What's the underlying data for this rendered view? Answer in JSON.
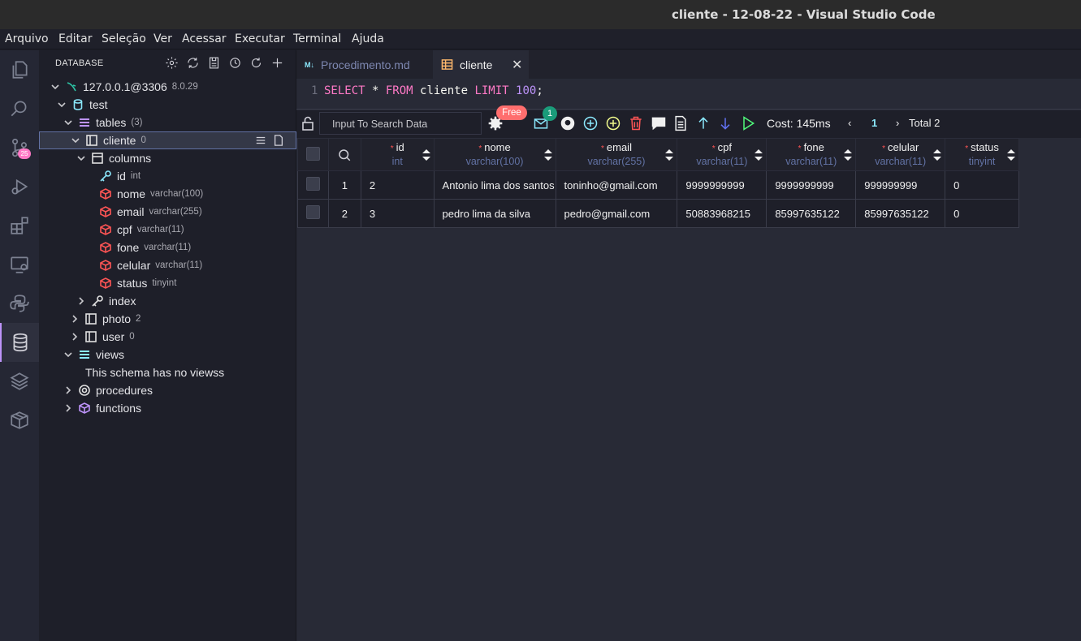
{
  "window": {
    "title": "cliente - 12-08-22 - Visual Studio Code"
  },
  "menu": [
    "Arquivo",
    "Editar",
    "Seleção",
    "Ver",
    "Acessar",
    "Executar",
    "Terminal",
    "Ajuda"
  ],
  "activity": {
    "scm_badge": "25"
  },
  "sidebar": {
    "header": "DATABASE",
    "connection": {
      "label": "127.0.0.1@3306",
      "version": "8.0.29"
    },
    "schema": "test",
    "tables": {
      "label": "tables",
      "count": "(3)"
    },
    "cliente": {
      "label": "cliente",
      "count": "0"
    },
    "columns_label": "columns",
    "columns": [
      {
        "name": "id",
        "type": "int"
      },
      {
        "name": "nome",
        "type": "varchar(100)"
      },
      {
        "name": "email",
        "type": "varchar(255)"
      },
      {
        "name": "cpf",
        "type": "varchar(11)"
      },
      {
        "name": "fone",
        "type": "varchar(11)"
      },
      {
        "name": "celular",
        "type": "varchar(11)"
      },
      {
        "name": "status",
        "type": "tinyint"
      }
    ],
    "index_label": "index",
    "photo": {
      "label": "photo",
      "count": "2"
    },
    "user": {
      "label": "user",
      "count": "0"
    },
    "views_label": "views",
    "views_empty": "This schema has no viewss",
    "procedures_label": "procedures",
    "functions_label": "functions"
  },
  "tabs": [
    {
      "label": "Procedimento.md",
      "icon": "M↓"
    },
    {
      "label": "cliente"
    }
  ],
  "editor": {
    "line": "1",
    "select": "SELECT",
    "star": " * ",
    "from": "FROM",
    "table": " cliente ",
    "limit": "LIMIT",
    "num": "100",
    "semi": ";"
  },
  "toolbar": {
    "search_placeholder": "Input To Search Data",
    "free_badge": "Free",
    "mail_badge": "1",
    "cost": "Cost: 145ms",
    "page": "1",
    "total": "Total 2"
  },
  "grid": {
    "columns": [
      {
        "name": "id",
        "type": "int"
      },
      {
        "name": "nome",
        "type": "varchar(100)"
      },
      {
        "name": "email",
        "type": "varchar(255)"
      },
      {
        "name": "cpf",
        "type": "varchar(11)"
      },
      {
        "name": "fone",
        "type": "varchar(11)"
      },
      {
        "name": "celular",
        "type": "varchar(11)"
      },
      {
        "name": "status",
        "type": "tinyint"
      }
    ],
    "rows": [
      {
        "n": "1",
        "id": "2",
        "nome": "Antonio lima dos santos",
        "email": "toninho@gmail.com",
        "cpf": "9999999999",
        "fone": "9999999999",
        "celular": "999999999",
        "status": "0"
      },
      {
        "n": "2",
        "id": "3",
        "nome": "pedro lima da silva",
        "email": "pedro@gmail.com",
        "cpf": "50883968215",
        "fone": "85997635122",
        "celular": "85997635122",
        "status": "0"
      }
    ]
  },
  "colors": {
    "accent": "#bd93f9",
    "pink": "#ff79c6",
    "bg": "#282a36",
    "sidebar": "#1e1f29"
  }
}
